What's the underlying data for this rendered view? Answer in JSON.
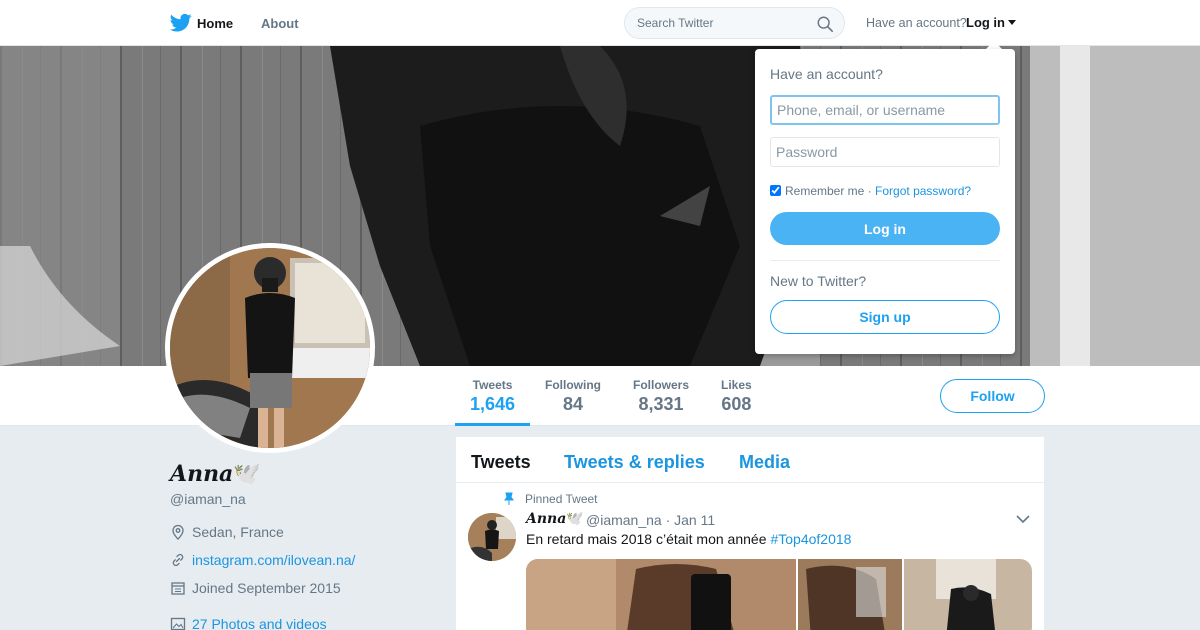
{
  "nav": {
    "home": "Home",
    "about": "About",
    "search_placeholder": "Search Twitter",
    "have_account": "Have an account?",
    "login": "Log in"
  },
  "profile": {
    "name": "Anna",
    "name_emoji": "🕊️",
    "handle": "@iaman_na",
    "location": "Sedan, France",
    "website": "instagram.com/ilovean.na/",
    "joined": "Joined September 2015",
    "photos": "27 Photos and videos"
  },
  "stats": [
    {
      "label": "Tweets",
      "value": "1,646"
    },
    {
      "label": "Following",
      "value": "84"
    },
    {
      "label": "Followers",
      "value": "8,331"
    },
    {
      "label": "Likes",
      "value": "608"
    }
  ],
  "follow_label": "Follow",
  "timeline": {
    "tabs": [
      "Tweets",
      "Tweets & replies",
      "Media"
    ],
    "pinned_label": "Pinned Tweet",
    "tweet": {
      "name": "Anna",
      "name_emoji": "🕊️",
      "handle_date": "@iaman_na · Jan 11",
      "text": "En retard mais 2018 c’était mon année",
      "hashtag": "#Top4of2018"
    }
  },
  "login_dropdown": {
    "title": "Have an account?",
    "username_placeholder": "Phone, email, or username",
    "password_placeholder": "Password",
    "remember": "Remember me",
    "separator": "·",
    "forgot": "Forgot password?",
    "login_button": "Log in",
    "new_to": "New to Twitter?",
    "signup_button": "Sign up"
  },
  "colors": {
    "accent": "#1da1f2",
    "link": "#1b95e0",
    "muted": "#657786",
    "login_button": "#4ab3f4"
  }
}
